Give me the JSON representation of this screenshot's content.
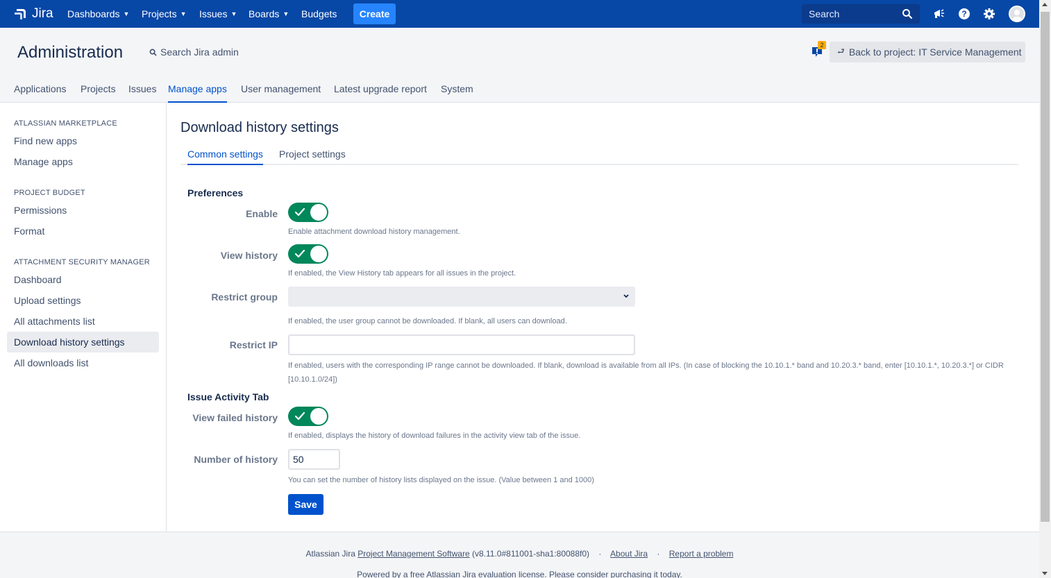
{
  "topnav": {
    "logo_text": "Jira",
    "items": [
      {
        "label": "Dashboards",
        "has_dropdown": true
      },
      {
        "label": "Projects",
        "has_dropdown": true
      },
      {
        "label": "Issues",
        "has_dropdown": true
      },
      {
        "label": "Boards",
        "has_dropdown": true
      },
      {
        "label": "Budgets",
        "has_dropdown": false
      }
    ],
    "create_label": "Create",
    "search_placeholder": "Search",
    "icons": [
      "megaphone-icon",
      "help-icon",
      "gear-icon",
      "avatar"
    ],
    "bg_color": "#0747a6",
    "create_color": "#2684ff"
  },
  "admin": {
    "title": "Administration",
    "search_label": "Search Jira admin",
    "notification_count": "2",
    "back_label": "Back to project: IT Service Management",
    "tabs": [
      "Applications",
      "Projects",
      "Issues",
      "Manage apps",
      "User management",
      "Latest upgrade report",
      "System"
    ],
    "active_tab": "Manage apps"
  },
  "sidebar": {
    "sections": [
      {
        "heading": "ATLASSIAN MARKETPLACE",
        "items": [
          "Find new apps",
          "Manage apps"
        ]
      },
      {
        "heading": "PROJECT BUDGET",
        "items": [
          "Permissions",
          "Format"
        ]
      },
      {
        "heading": "ATTACHMENT SECURITY MANAGER",
        "items": [
          "Dashboard",
          "Upload settings",
          "All attachments list",
          "Download history settings",
          "All downloads list"
        ]
      }
    ],
    "active_item": "Download history settings"
  },
  "main": {
    "title": "Download history settings",
    "tabs": [
      "Common settings",
      "Project settings"
    ],
    "active_tab": "Common settings",
    "preferences": {
      "heading": "Preferences",
      "enable_label": "Enable",
      "enable_help": "Enable attachment download history management.",
      "view_history_label": "View history",
      "view_history_help": "If enabled, the View History tab appears for all issues in the project.",
      "restrict_group_label": "Restrict group",
      "restrict_group_value": "",
      "restrict_group_help": "If enabled, the user group cannot be downloaded. If blank, all users can download.",
      "restrict_ip_label": "Restrict IP",
      "restrict_ip_value": "",
      "restrict_ip_help_1": "If enabled, users with the corresponding IP range cannot be downloaded. If blank, download is available from all IPs. (In case of blocking the 10.10.1.* band and 10.20.3.* band, enter [10.10.1.*, 10.20.3.*] or CIDR",
      "restrict_ip_help_2": "[10.10.1.0/24])"
    },
    "activity": {
      "heading": "Issue Activity Tab",
      "view_failed_label": "View failed history",
      "view_failed_help": "If enabled, displays the history of download failures in the activity view tab of the issue.",
      "number_label": "Number of history",
      "number_value": "50",
      "number_help": "You can set the number of history lists displayed on the issue. (Value between 1 and 1000)"
    },
    "save_label": "Save",
    "toggle_color": "#00875a"
  },
  "footer": {
    "prefix": "Atlassian Jira",
    "link_software": "Project Management Software",
    "version": "(v8.11.0#811001-sha1:80088f0)",
    "link_about": "About Jira",
    "link_report": "Report a problem",
    "license": "Powered by a free Atlassian Jira evaluation license. Please consider purchasing it today."
  }
}
